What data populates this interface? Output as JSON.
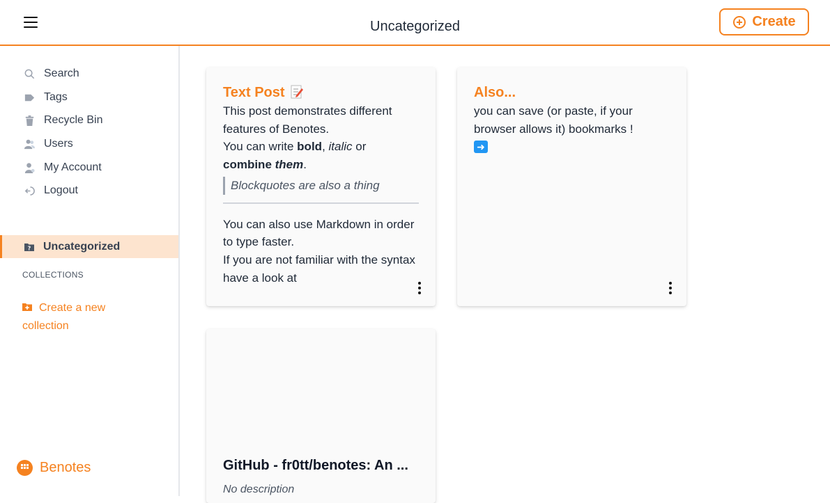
{
  "header": {
    "title": "Uncategorized",
    "create_label": "Create"
  },
  "sidebar": {
    "items": [
      {
        "label": "Search",
        "icon": "search-icon"
      },
      {
        "label": "Tags",
        "icon": "tag-icon"
      },
      {
        "label": "Recycle Bin",
        "icon": "trash-icon"
      },
      {
        "label": "Users",
        "icon": "users-icon"
      },
      {
        "label": "My Account",
        "icon": "user-icon"
      },
      {
        "label": "Logout",
        "icon": "logout-icon"
      }
    ],
    "active_collection": "Uncategorized",
    "collections_label": "COLLECTIONS",
    "create_collection_label": "Create a new collection",
    "brand": "Benotes"
  },
  "cards": {
    "text_post": {
      "title": "Text Post",
      "line1": "This post demonstrates different features of Benotes.",
      "write_prefix": "You can write ",
      "bold": "bold",
      "comma": ", ",
      "italic": "italic",
      "or": " or",
      "combine": "combine ",
      "them": "them",
      "period": ".",
      "quote": "Blockquotes are also a thing",
      "markdown": "You can also use Markdown in order to type faster.",
      "familiar": "If you are not familiar with the syntax have a look at"
    },
    "also": {
      "title": "Also...",
      "text": "you can save (or paste, if your browser allows it) bookmarks !"
    },
    "bookmark": {
      "title": "GitHub - fr0tt/benotes: An ...",
      "description": "No description"
    }
  },
  "colors": {
    "accent": "#f58220",
    "active_bg": "#fde4cf"
  }
}
